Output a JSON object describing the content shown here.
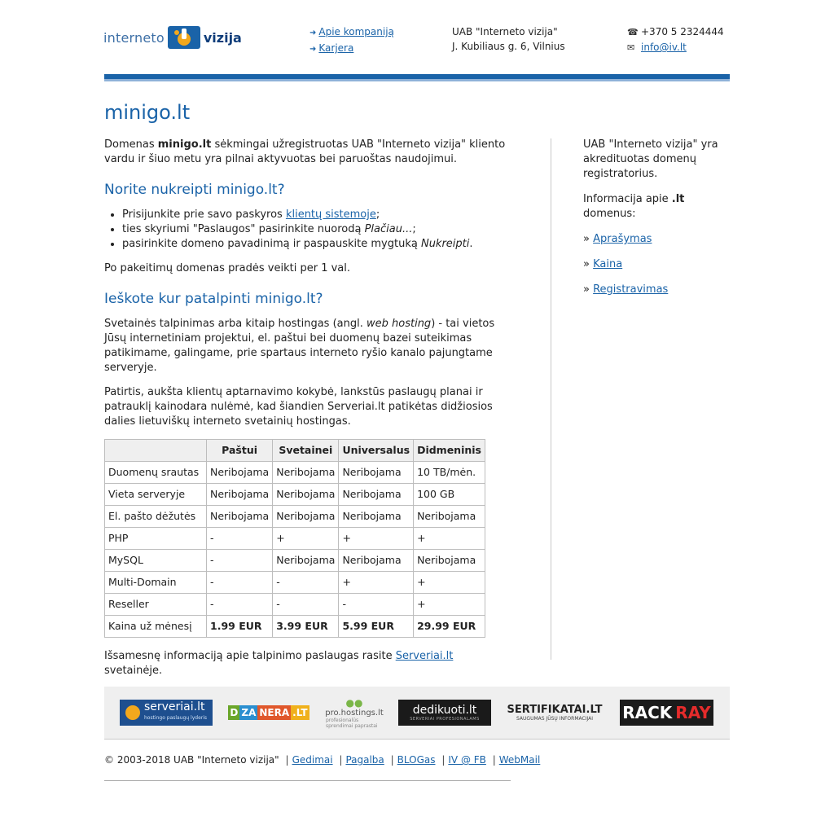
{
  "header": {
    "logo_word1": "interneto",
    "logo_word2": "vizija",
    "links": [
      "Apie kompaniją",
      "Karjera"
    ],
    "company_name": "UAB \"Interneto vizija\"",
    "address": "J. Kubiliaus g. 6, Vilnius",
    "phone": "+370 5 2324444",
    "email": "info@iv.lt",
    "icons": {
      "link_arrow": "arrow-right-icon",
      "phone": "phone-icon",
      "email": "envelope-icon"
    }
  },
  "page_title": "minigo.lt",
  "intro": {
    "before": "Domenas ",
    "domain": "minigo.lt",
    "after": " sėkmingai užregistruotas UAB \"Interneto vizija\" kliento vardu ir šiuo metu yra pilnai aktyvuotas bei paruoštas naudojimui."
  },
  "section1": {
    "heading": "Norite nukreipti minigo.lt?",
    "item1_before": "Prisijunkite prie savo paskyros ",
    "item1_link": "klientų sistemoje",
    "item1_after": ";",
    "item2_before": "ties skyriumi \"Paslaugos\" pasirinkite nuorodą ",
    "item2_em": "Plačiau...",
    "item2_after": ";",
    "item3_before": "pasirinkite domeno pavadinimą ir paspauskite mygtuką ",
    "item3_em": "Nukreipti",
    "item3_after": ".",
    "note": "Po pakeitimų domenas pradės veikti per 1 val."
  },
  "section2": {
    "heading": "Ieškote kur patalpinti minigo.lt?",
    "p1_before": "Svetainės talpinimas arba kitaip hostingas (angl. ",
    "p1_em": "web hosting",
    "p1_after": ") - tai vietos Jūsų internetiniam projektui, el. paštui bei duomenų bazei suteikimas patikimame, galingame, prie spartaus interneto ryšio kanalo pajungtame serveryje.",
    "p2": "Patirtis, aukšta klientų aptarnavimo kokybė, lankstūs paslaugų planai ir patrauklį kainodara nulėmė, kad šiandien Serveriai.lt patikėtas didžiosios dalies lietuviškų interneto svetainių hostingas.",
    "closing_before": "Išsamesnę informaciją apie talpinimo paslaugas rasite ",
    "closing_link": "Serveriai.lt",
    "closing_after": " svetainėje."
  },
  "table": {
    "headers": [
      "",
      "Paštui",
      "Svetainei",
      "Universalus",
      "Didmeninis"
    ],
    "rows": [
      [
        "Duomenų srautas",
        "Neribojama",
        "Neribojama",
        "Neribojama",
        "10 TB/mėn."
      ],
      [
        "Vieta serveryje",
        "Neribojama",
        "Neribojama",
        "Neribojama",
        "100 GB"
      ],
      [
        "El. pašto dėžutės",
        "Neribojama",
        "Neribojama",
        "Neribojama",
        "Neribojama"
      ],
      [
        "PHP",
        "-",
        "+",
        "+",
        "+"
      ],
      [
        "MySQL",
        "-",
        "Neribojama",
        "Neribojama",
        "Neribojama"
      ],
      [
        "Multi-Domain",
        "-",
        "-",
        "+",
        "+"
      ],
      [
        "Reseller",
        "-",
        "-",
        "-",
        "+"
      ],
      [
        "Kaina už mėnesį",
        "1.99 EUR",
        "3.99 EUR",
        "5.99 EUR",
        "29.99 EUR"
      ]
    ]
  },
  "sidebar": {
    "p1": "UAB \"Interneto vizija\" yra akredituotas domenų registratorius.",
    "p2_before": "Informacija apie ",
    "p2_bold": ".lt",
    "p2_after": " domenus:",
    "bullet": "»",
    "links": [
      "Aprašymas",
      "Kaina",
      "Registravimas"
    ]
  },
  "partners": {
    "serveriai": "serveriai.lt",
    "serveriai_sub": "hostingo paslaugų lyderis",
    "dzanera": [
      "D",
      "ZA",
      "NERA",
      ".LT"
    ],
    "prohostings": "pro.hostings.lt",
    "prohostings_sub": "profesionalūs sprendimai paprastai",
    "dedikuoti": "dedikuoti.lt",
    "dedikuoti_sub": "SERVERIAI PROFESIONALAMS",
    "sertifikatai": "SERTIFIKATAI.LT",
    "sertifikatai_sub": "SAUGUMAS JŪSŲ INFORMACIJAI",
    "rack": "RACK",
    "ray": "RAY"
  },
  "footer": {
    "copyright": "© 2003-2018 UAB \"Interneto vizija\"",
    "separator": "|",
    "links": [
      "Gedimai",
      "Pagalba",
      "BLOGas",
      "IV @ FB",
      "WebMail"
    ]
  }
}
